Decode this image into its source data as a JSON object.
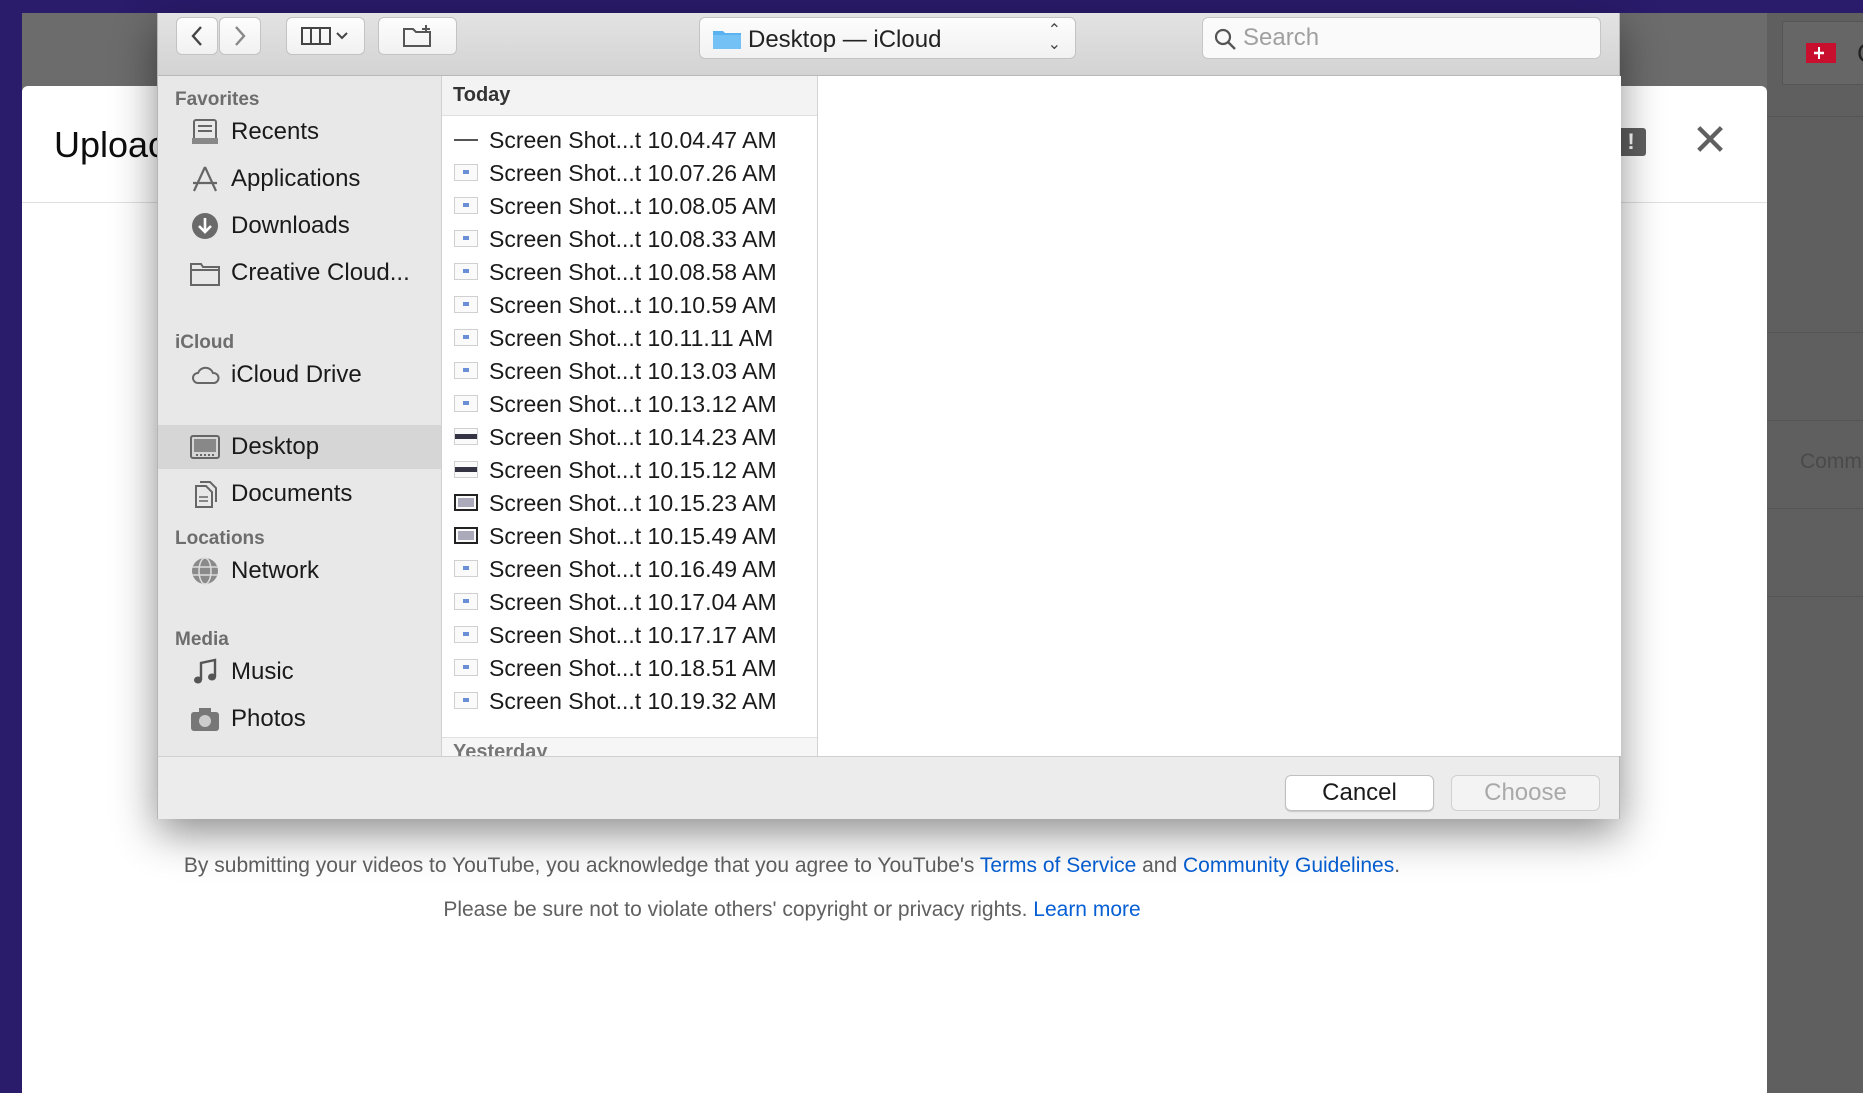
{
  "youtube": {
    "dialog_title": "Uploac",
    "create_label": "C",
    "side_text": "Comm",
    "footer_line1_prefix": "By submitting your videos to YouTube, you acknowledge that you agree to YouTube's ",
    "terms_link": "Terms of Service",
    "footer_line1_mid": " and ",
    "guidelines_link": "Community Guidelines",
    "footer_line1_suffix": ".",
    "footer_line2_prefix": "Please be sure not to violate others' copyright or privacy rights. ",
    "learn_more_link": "Learn more",
    "feedback_icon": "feedback-icon",
    "close_icon": "close-icon"
  },
  "chooser": {
    "location": "Desktop — iCloud",
    "search_placeholder": "Search",
    "search_value": "",
    "sidebar": {
      "sections": [
        {
          "title": "Favorites",
          "items": [
            {
              "label": "Recents",
              "icon": "recents-icon"
            },
            {
              "label": "Applications",
              "icon": "applications-icon"
            },
            {
              "label": "Downloads",
              "icon": "downloads-icon"
            },
            {
              "label": "Creative Cloud...",
              "icon": "folder-icon"
            }
          ]
        },
        {
          "title": "iCloud",
          "items": [
            {
              "label": "iCloud Drive",
              "icon": "cloud-icon"
            },
            {
              "label": "Desktop",
              "icon": "desktop-icon",
              "selected": true
            },
            {
              "label": "Documents",
              "icon": "documents-icon"
            }
          ]
        },
        {
          "title": "Locations",
          "items": [
            {
              "label": "Network",
              "icon": "network-icon"
            }
          ]
        },
        {
          "title": "Media",
          "items": [
            {
              "label": "Music",
              "icon": "music-icon"
            },
            {
              "label": "Photos",
              "icon": "camera-icon"
            }
          ]
        }
      ]
    },
    "column_header": "Today",
    "next_header": "Yesterday",
    "files": [
      "Screen Shot...t 10.04.47 AM",
      "Screen Shot...t 10.07.26 AM",
      "Screen Shot...t 10.08.05 AM",
      "Screen Shot...t 10.08.33 AM",
      "Screen Shot...t 10.08.58 AM",
      "Screen Shot...t 10.10.59 AM",
      "Screen Shot...t 10.11.11 AM",
      "Screen Shot...t 10.13.03 AM",
      "Screen Shot...t 10.13.12 AM",
      "Screen Shot...t 10.14.23 AM",
      "Screen Shot...t 10.15.12 AM",
      "Screen Shot...t 10.15.23 AM",
      "Screen Shot...t 10.15.49 AM",
      "Screen Shot...t 10.16.49 AM",
      "Screen Shot...t 10.17.04 AM",
      "Screen Shot...t 10.17.17 AM",
      "Screen Shot...t 10.18.51 AM",
      "Screen Shot...t 10.19.32 AM"
    ],
    "buttons": {
      "cancel": "Cancel",
      "choose": "Choose"
    }
  },
  "colors": {
    "desktop_background": "#2a1b6b",
    "link_blue": "#065fd4",
    "folder_blue": "#5ab3f0",
    "record_red": "#c8102e"
  }
}
